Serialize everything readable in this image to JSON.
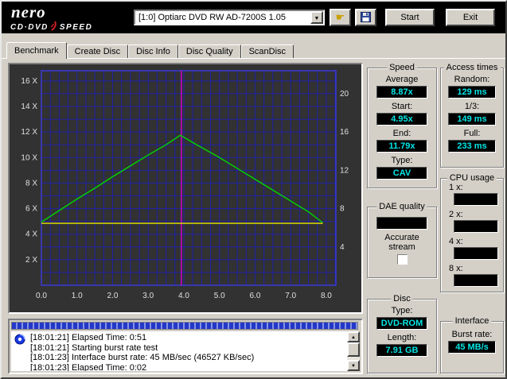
{
  "header": {
    "logo_line1": "nero",
    "logo_cd": "CD·DVD",
    "logo_speed": "SPEED",
    "drive_select": "[1:0]    Optiarc DVD RW AD-7200S 1.05",
    "start_button": "Start",
    "exit_button": "Exit"
  },
  "tabs": [
    {
      "label": "Benchmark",
      "active": true
    },
    {
      "label": "Create Disc",
      "active": false
    },
    {
      "label": "Disc Info",
      "active": false
    },
    {
      "label": "Disc Quality",
      "active": false
    },
    {
      "label": "ScanDisc",
      "active": false
    }
  ],
  "chart_data": {
    "type": "line",
    "background": "#323232",
    "xlim": [
      0,
      8.27
    ],
    "x_ticks": [
      {
        "v": 0,
        "label": "0.0"
      },
      {
        "v": 1,
        "label": "1.0"
      },
      {
        "v": 2,
        "label": "2.0"
      },
      {
        "v": 3,
        "label": "3.0"
      },
      {
        "v": 4,
        "label": "4.0"
      },
      {
        "v": 5,
        "label": "5.0"
      },
      {
        "v": 6,
        "label": "6.0"
      },
      {
        "v": 7,
        "label": "7.0"
      },
      {
        "v": 8,
        "label": "8.0"
      }
    ],
    "left_axis": {
      "unit": "X",
      "ticks": [
        2,
        4,
        6,
        8,
        10,
        12,
        14,
        16
      ],
      "lim": [
        0,
        16.8
      ]
    },
    "right_axis": {
      "ticks": [
        4,
        8,
        12,
        16,
        20
      ],
      "lim": [
        0,
        22.4
      ]
    },
    "grid": {
      "x_step": 0.25,
      "y_step": 1,
      "color": "#2020a8",
      "border_color": "#3a3ad8"
    },
    "series": [
      {
        "name": "read-speed",
        "color": "#00d800",
        "points": [
          [
            0,
            4.95
          ],
          [
            0.5,
            5.85
          ],
          [
            1,
            6.75
          ],
          [
            1.5,
            7.6
          ],
          [
            2,
            8.5
          ],
          [
            2.5,
            9.35
          ],
          [
            3,
            10.2
          ],
          [
            3.5,
            11.0
          ],
          [
            3.9,
            11.75
          ],
          [
            4.3,
            11.1
          ],
          [
            5,
            10.0
          ],
          [
            5.5,
            9.15
          ],
          [
            6,
            8.3
          ],
          [
            6.5,
            7.45
          ],
          [
            7,
            6.6
          ],
          [
            7.5,
            5.75
          ],
          [
            7.9,
            4.9
          ]
        ]
      },
      {
        "name": "rotation-speed",
        "color": "#e8e800",
        "points": [
          [
            0,
            4.85
          ],
          [
            7.9,
            4.85
          ]
        ]
      }
    ],
    "marker_line": {
      "x": 3.93,
      "color": "#cc00cc"
    }
  },
  "panels": {
    "speed": {
      "title": "Speed",
      "average_label": "Average",
      "average": "8.87x",
      "start_label": "Start:",
      "start": "4.95x",
      "end_label": "End:",
      "end": "11.79x",
      "type_label": "Type:",
      "type": "CAV"
    },
    "dae": {
      "title": "DAE quality",
      "value": "",
      "accurate_stream_label": "Accurate stream"
    },
    "access": {
      "title": "Access times",
      "random_label": "Random:",
      "random": "129 ms",
      "third_label": "1/3:",
      "third": "149 ms",
      "full_label": "Full:",
      "full": "233 ms"
    },
    "cpu": {
      "title": "CPU usage",
      "rows": [
        {
          "label": "1 x:",
          "value": ""
        },
        {
          "label": "2 x:",
          "value": ""
        },
        {
          "label": "4 x:",
          "value": ""
        },
        {
          "label": "8 x:",
          "value": ""
        }
      ]
    },
    "disc": {
      "title": "Disc",
      "type_label": "Type:",
      "type": "DVD-ROM",
      "length_label": "Length:",
      "length": "7.91 GB"
    },
    "interface": {
      "title": "Interface",
      "burst_label": "Burst rate:",
      "burst": "45 MB/s"
    }
  },
  "log": {
    "lines": [
      "[18:01:21]  Elapsed Time:  0:51",
      "[18:01:21]  Starting burst rate test",
      "[18:01:23]  Interface burst rate: 45 MB/sec (46527 KB/sec)",
      "[18:01:23]  Elapsed Time:  0:02"
    ]
  }
}
